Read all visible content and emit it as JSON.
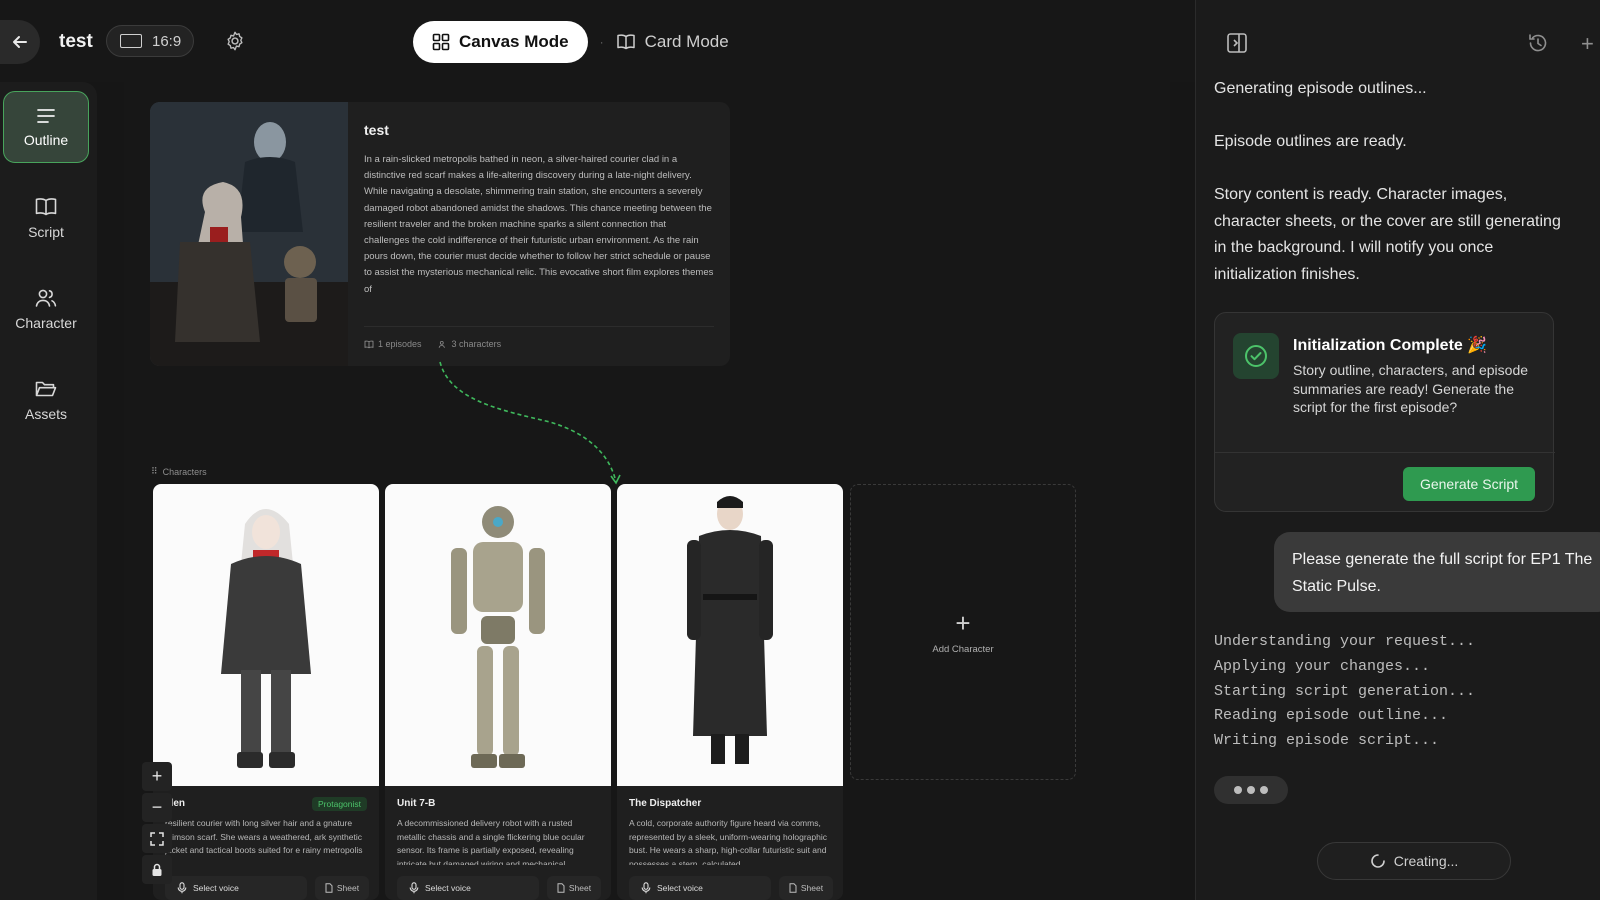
{
  "header": {
    "project_title": "test",
    "aspect_ratio": "16:9",
    "modes": {
      "active": "Canvas Mode",
      "inactive": "Card Mode"
    }
  },
  "sidebar": {
    "items": [
      {
        "label": "Outline",
        "icon": "list-icon",
        "active": true
      },
      {
        "label": "Script",
        "icon": "book-icon",
        "active": false
      },
      {
        "label": "Character",
        "icon": "users-icon",
        "active": false
      },
      {
        "label": "Assets",
        "icon": "folder-icon",
        "active": false
      }
    ]
  },
  "story": {
    "title": "test",
    "synopsis": "In a rain-slicked metropolis bathed in neon, a silver-haired courier clad in a distinctive red scarf makes a life-altering discovery during a late-night delivery. While navigating a desolate, shimmering train station, she encounters a severely damaged robot abandoned amidst the shadows. This chance meeting between the resilient traveler and the broken machine sparks a silent connection that challenges the cold indifference of their futuristic urban environment. As the rain pours down, the courier must decide whether to follow her strict schedule or pause to assist the mysterious mechanical relic. This evocative short film explores themes of",
    "episodes": "1 episodes",
    "characters": "3 characters"
  },
  "characters_section": {
    "label": "Characters"
  },
  "characters": [
    {
      "name": "elen",
      "badge": "Protagonist",
      "desc": "resilient courier with long silver hair and a gnature crimson scarf. She wears a weathered, ark synthetic jacket and tactical boots suited for e rainy metropolis",
      "voice_label": "Select voice",
      "sheet_label": "Sheet"
    },
    {
      "name": "Unit 7-B",
      "badge": "",
      "desc": "A decommissioned delivery robot with a rusted metallic chassis and a single flickering blue ocular sensor. Its frame is partially exposed, revealing intricate but damaged wiring and mechanical",
      "voice_label": "Select voice",
      "sheet_label": "Sheet"
    },
    {
      "name": "The Dispatcher",
      "badge": "",
      "desc": "A cold, corporate authority figure heard via comms, represented by a sleek, uniform-wearing holographic bust. He wears a sharp, high-collar futuristic suit and possesses a stern, calculated",
      "voice_label": "Select voice",
      "sheet_label": "Sheet"
    }
  ],
  "add_character": {
    "label": "Add Character"
  },
  "zoom_controls": [
    "plus-icon",
    "minus-icon",
    "fit-icon",
    "lock-icon"
  ],
  "chat": {
    "messages": [
      "Generating episode outlines...",
      "Episode outlines are ready.",
      "Story content is ready. Character images, character sheets, or the cover are still generating in the background. I will notify you once initialization finishes."
    ],
    "init_card": {
      "title": "Initialization Complete 🎉",
      "text": "Story outline, characters, and episode summaries are ready! Generate the script for the first episode?",
      "button": "Generate Script"
    },
    "user_message": "Please generate the full script for EP1 The Static Pulse.",
    "log": [
      "Understanding your request...",
      "Applying your changes...",
      "Starting script generation...",
      "Reading episode outline...",
      "Writing episode script..."
    ],
    "status_button": "Creating..."
  },
  "colors": {
    "accent_green": "#2f9a50",
    "active_border": "#48a45c",
    "background": "#161616"
  }
}
